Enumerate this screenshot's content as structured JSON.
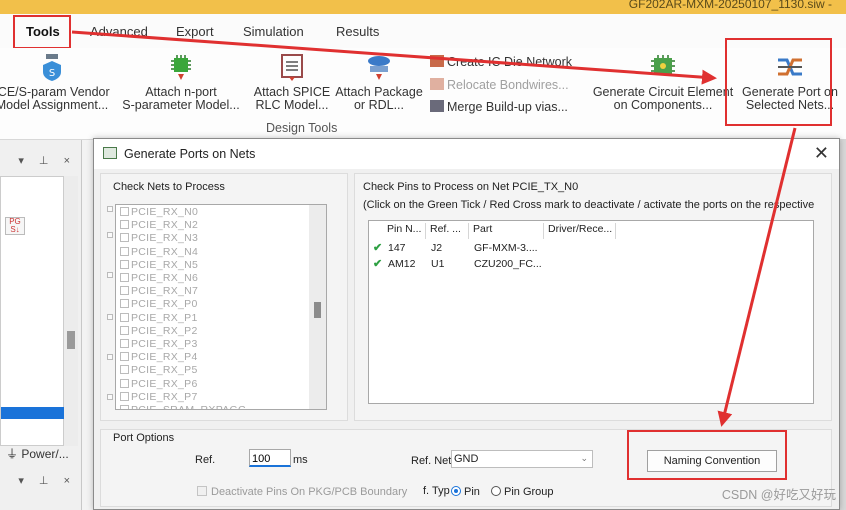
{
  "window": {
    "title": "GF202AR-MXM-20250107_1130.siw -"
  },
  "ribbon_tabs": [
    "Tools",
    "Advanced",
    "Export",
    "Simulation",
    "Results"
  ],
  "ribbon": {
    "vendor_button": [
      "ICE/S-param Vendor",
      "Model Assignment..."
    ],
    "nport_button": [
      "Attach n-port",
      "S-parameter Model..."
    ],
    "spice_button": [
      "Attach SPICE",
      "RLC Model..."
    ],
    "package_button": [
      "Attach Package",
      "or RDL..."
    ],
    "create_ic_die": "Create IC Die Network",
    "relocate_bondwires": "Relocate Bondwires...",
    "merge_vias": "Merge Build-up vias...",
    "circuit_element_button": [
      "Generate Circuit Element",
      "on Components..."
    ],
    "generate_port_button": [
      "Generate Port on",
      "Selected Nets..."
    ],
    "group_label": "Design Tools"
  },
  "left_dock": {
    "panel_label": "Power/..."
  },
  "dialog": {
    "title": "Generate Ports on Nets",
    "check_nets_label": "Check Nets to Process",
    "nets": [
      "PCIE_RX_N0",
      "PCIE_RX_N2",
      "PCIE_RX_N3",
      "PCIE_RX_N4",
      "PCIE_RX_N5",
      "PCIE_RX_N6",
      "PCIE_RX_N7",
      "PCIE_RX_P0",
      "PCIE_RX_P1",
      "PCIE_RX_P2",
      "PCIE_RX_P3",
      "PCIE_RX_P4",
      "PCIE_RX_P5",
      "PCIE_RX_P6",
      "PCIE_RX_P7",
      "PCIE_SRAM_RXPAGC"
    ],
    "check_pins_label": "Check Pins to Process on Net PCIE_TX_N0",
    "pins_hint": "(Click on the Green Tick / Red Cross mark to deactivate / activate the ports on the respective",
    "pin_columns": [
      "Pin N...",
      "Ref. ...",
      "Part",
      "Driver/Rece..."
    ],
    "pins": [
      {
        "pin": "147",
        "ref": "J2",
        "part": "GF-MXM-3...."
      },
      {
        "pin": "AM12",
        "ref": "U1",
        "part": "CZU200_FC..."
      }
    ],
    "port_options": {
      "label": "Port Options",
      "ref_label": "Ref.",
      "ref_value": "100",
      "ref_unit": "ms",
      "ref_net_label": "Ref. Net",
      "ref_net_value": "GND",
      "naming_button": "Naming Convention",
      "deactivate_label": "Deactivate Pins On PKG/PCB Boundary",
      "type_label": "f. Typ",
      "pin_radio": "Pin",
      "pin_group_radio": "Pin Group"
    }
  },
  "watermark": "CSDN @好吃又好玩",
  "colors": {
    "highlight": "#e03030",
    "accent": "#1a73d9",
    "tick": "#2ea043",
    "titlebar": "#f2c04a"
  }
}
